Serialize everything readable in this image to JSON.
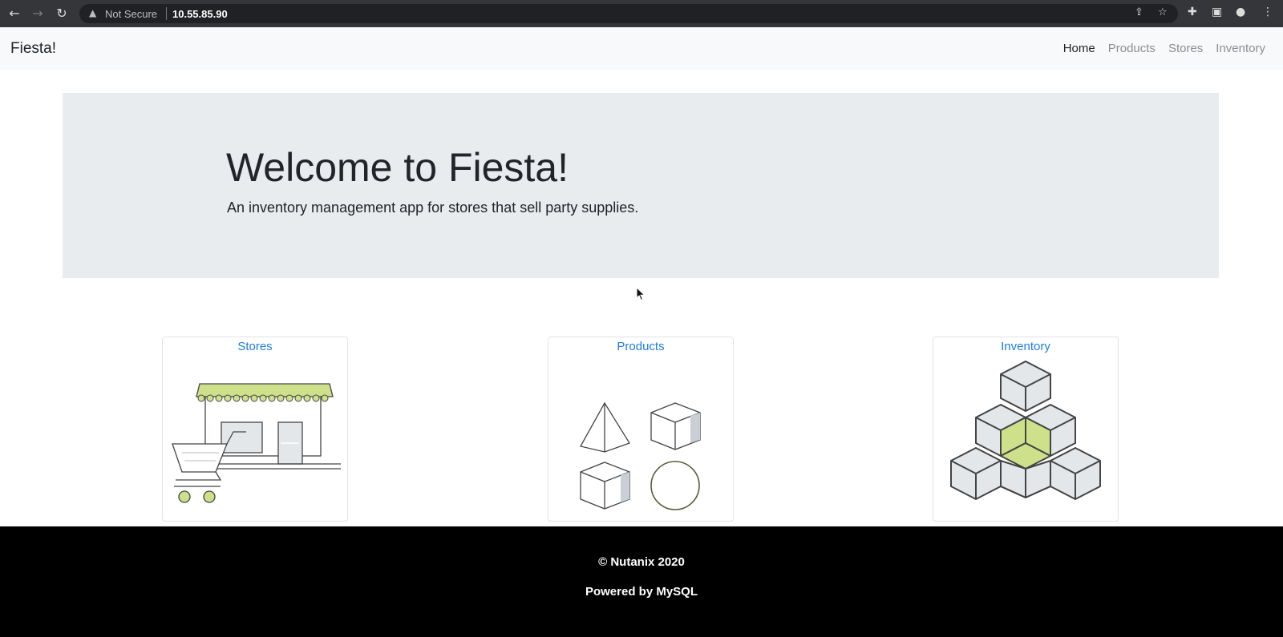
{
  "browser": {
    "security_label": "Not Secure",
    "url": "10.55.85.90",
    "icons": [
      "back-arrow-icon",
      "forward-arrow-icon",
      "reload-icon",
      "warning-icon",
      "share-icon",
      "star-icon",
      "extensions-icon",
      "sidebar-icon",
      "profile-icon",
      "menu-icon"
    ]
  },
  "navbar": {
    "brand": "Fiesta!",
    "links": [
      "Home",
      "Products",
      "Stores",
      "Inventory"
    ],
    "active": "Home"
  },
  "jumbotron": {
    "title": "Welcome to Fiesta!",
    "subtitle": "An inventory management app for stores that sell party supplies."
  },
  "cards": [
    {
      "title": "Stores",
      "illustration": "storefront-cart-icon"
    },
    {
      "title": "Products",
      "illustration": "shapes-icon"
    },
    {
      "title": "Inventory",
      "illustration": "stacked-cubes-icon"
    }
  ],
  "footer": {
    "copyright": "© Nutanix 2020",
    "powered": "Powered by MySQL"
  },
  "colors": {
    "accent_green": "#cfe08a",
    "link_blue": "#1f7be2",
    "jumbotron_bg": "#e9ecef",
    "navbar_bg": "#f8f9fa",
    "footer_bg": "#000000"
  }
}
